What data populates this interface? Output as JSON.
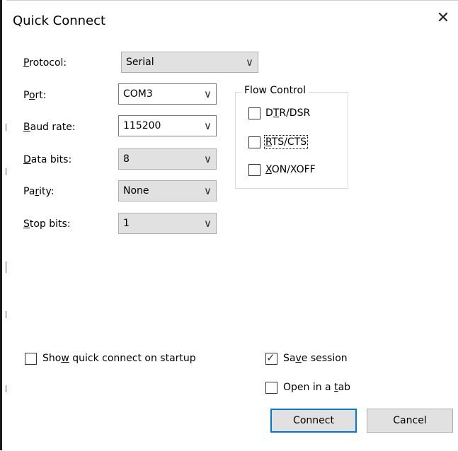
{
  "dialog": {
    "title": "Quick Connect",
    "close_symbol": "✕"
  },
  "fields": {
    "protocol": {
      "label_pre": "",
      "label_u": "P",
      "label_post": "rotocol:",
      "value": "Serial"
    },
    "port": {
      "label_pre": "P",
      "label_u": "o",
      "label_post": "rt:",
      "value": "COM3"
    },
    "baud_rate": {
      "label_pre": "",
      "label_u": "B",
      "label_post": "aud rate:",
      "value": "115200"
    },
    "data_bits": {
      "label_pre": "",
      "label_u": "D",
      "label_post": "ata bits:",
      "value": "8"
    },
    "parity": {
      "label_pre": "Pa",
      "label_u": "r",
      "label_post": "ity:",
      "value": "None"
    },
    "stop_bits": {
      "label_pre": "",
      "label_u": "S",
      "label_post": "top bits:",
      "value": "1"
    }
  },
  "chevron_symbol": "∨",
  "flow_control": {
    "title": "Flow Control",
    "options": [
      {
        "pre": "D",
        "u": "T",
        "post": "R/DSR",
        "checked": false
      },
      {
        "pre": "",
        "u": "R",
        "post": "TS/CTS",
        "checked": false
      },
      {
        "pre": "",
        "u": "X",
        "post": "ON/XOFF",
        "checked": false
      }
    ]
  },
  "options": {
    "show_quick_connect": {
      "pre": "Sho",
      "u": "w",
      "post": " quick connect on startup",
      "checked": false
    },
    "save_session": {
      "pre": "Sa",
      "u": "v",
      "post": "e session",
      "checked": true
    },
    "open_in_tab": {
      "pre": "Open in a ",
      "u": "t",
      "post": "ab",
      "checked": false
    }
  },
  "check_symbol": "✓",
  "buttons": {
    "connect": "Connect",
    "cancel": "Cancel"
  }
}
